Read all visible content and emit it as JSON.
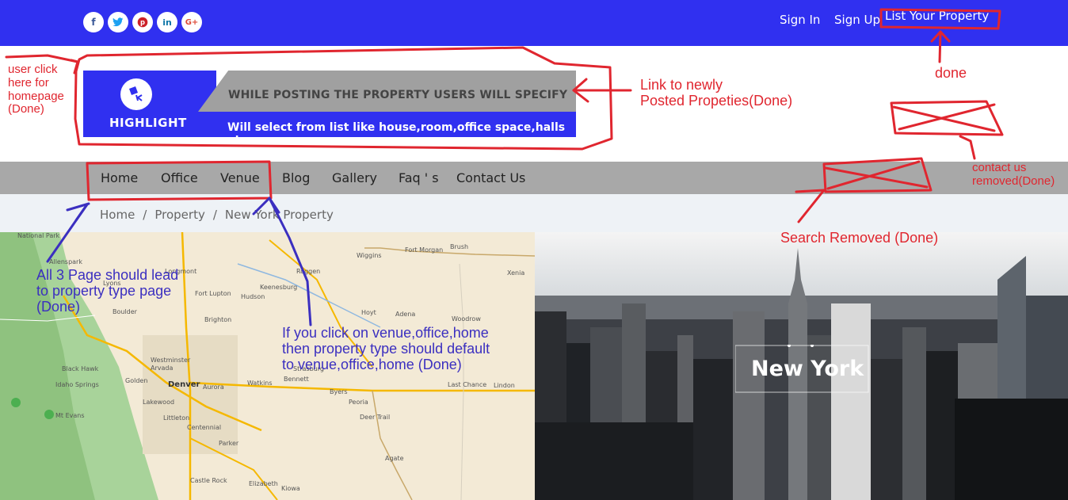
{
  "topbar": {
    "social": [
      {
        "icon": "facebook-icon",
        "glyph": "f",
        "color": "#3b5998"
      },
      {
        "icon": "twitter-icon",
        "glyph": "t",
        "color": "#1da1f2"
      },
      {
        "icon": "pinterest-icon",
        "glyph": "p",
        "color": "#cb2027"
      },
      {
        "icon": "linkedin-icon",
        "glyph": "in",
        "color": "#0e76a8"
      },
      {
        "icon": "google-plus-icon",
        "glyph": "G+",
        "color": "#dd4b39"
      }
    ],
    "sign_in": "Sign In",
    "sign_up": "Sign Up",
    "list_property": "List Your Property"
  },
  "banner": {
    "logo_text": "HIGHLIGHT",
    "heading": "WHILE POSTING THE PROPERTY USERS WILL SPECIFY",
    "subheading": "Will select from list like house,room,office space,halls etc."
  },
  "nav": {
    "items": [
      "Home",
      "Office",
      "Venue",
      "Blog",
      "Gallery",
      "Faq ' s",
      "Contact Us"
    ]
  },
  "breadcrumb": {
    "items": [
      "Home",
      "Property",
      "New York Property"
    ],
    "separator": "/"
  },
  "map": {
    "labels": [
      "National Park",
      "Allenspark",
      "Lyons",
      "Longmont",
      "Boulder",
      "Brighton",
      "Westminster",
      "Arvada",
      "Black Hawk",
      "Golden",
      "Denver",
      "Aurora",
      "Idaho Springs",
      "Lakewood",
      "Littleton",
      "Centennial",
      "Mt Evans",
      "Parker",
      "Castle Rock",
      "Elizabeth",
      "Kiowa",
      "Watkins",
      "Bennett",
      "Byers",
      "Deer Trail",
      "Agate",
      "Strasburg",
      "Keenesburg",
      "Hudson",
      "Fort Lupton",
      "Wiggins",
      "Fort Morgan",
      "Brush",
      "Roggen",
      "Hoyt",
      "Adena",
      "Woodrow",
      "Last Chance",
      "Lindon",
      "Peoria",
      "Xenia"
    ]
  },
  "city": {
    "title": "New York"
  },
  "annotations": {
    "homepage": "user click\nhere for\nhomepage\n(Done)",
    "posted": "Link to newly\nPosted Propeties(Done)",
    "done": "done",
    "contact_removed": "contact us\nremoved(Done)",
    "search_removed": "Search Removed (Done)",
    "pages_lead": "All 3 Page should lead\nto property type page\n(Done)",
    "venue_default": "If you click on venue,office,home\n then property type should default\nto venue,office,home (Done)"
  },
  "colors": {
    "brand_blue": "#3030f0",
    "nav_grey": "#a8a8a8",
    "annotation_red": "#e0262f",
    "annotation_navy": "#3b2fc0"
  }
}
